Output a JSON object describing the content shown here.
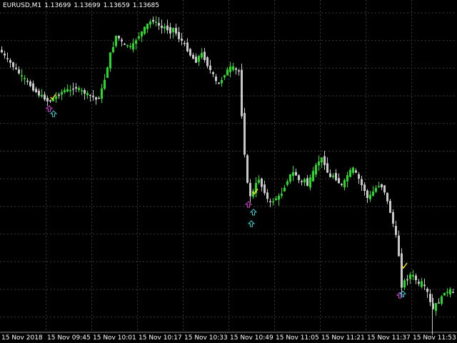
{
  "chart_header": {
    "symbol_timeframe": "EURUSD,M1",
    "open": "1.13699",
    "high": "1.13699",
    "low": "1.13659",
    "close": "1.13685"
  },
  "colors": {
    "background": "#000000",
    "grid": "#3a3a3a",
    "bull_candle": "#22dd22",
    "bear_candle": "#c8c8c8",
    "text": "#ffffff",
    "buy_arrow": "#d040d0",
    "buy_arrow_alt": "#40c8c8",
    "check_mark": "#f0e020"
  },
  "chart_data": {
    "type": "candlestick",
    "symbol": "EURUSD",
    "timeframe": "M1",
    "grid": true,
    "x_ticks": [
      "15 Nov 2018",
      "15 Nov 09:45",
      "15 Nov 10:01",
      "15 Nov 10:17",
      "15 Nov 10:33",
      "15 Nov 10:49",
      "15 Nov 11:05",
      "15 Nov 11:21",
      "15 Nov 11:37",
      "15 Nov 11:53"
    ],
    "price_path": [
      [
        0,
        1.1401
      ],
      [
        4,
        1.1399
      ],
      [
        8,
        1.1396
      ],
      [
        14,
        1.1392
      ],
      [
        20,
        1.1388
      ],
      [
        26,
        1.1384
      ],
      [
        32,
        1.138
      ],
      [
        38,
        1.1377
      ],
      [
        44,
        1.1373
      ],
      [
        50,
        1.1369
      ],
      [
        56,
        1.1366
      ],
      [
        62,
        1.1364
      ],
      [
        66,
        1.1362
      ],
      [
        70,
        1.136
      ],
      [
        76,
        1.1363
      ],
      [
        82,
        1.1365
      ],
      [
        88,
        1.1368
      ],
      [
        94,
        1.137
      ],
      [
        100,
        1.1369
      ],
      [
        106,
        1.1372
      ],
      [
        112,
        1.137
      ],
      [
        118,
        1.1368
      ],
      [
        124,
        1.1366
      ],
      [
        130,
        1.1365
      ],
      [
        136,
        1.1362
      ],
      [
        140,
        1.1364
      ],
      [
        144,
        1.137
      ],
      [
        148,
        1.1378
      ],
      [
        152,
        1.1388
      ],
      [
        156,
        1.1398
      ],
      [
        160,
        1.1404
      ],
      [
        164,
        1.1412
      ],
      [
        168,
        1.141
      ],
      [
        172,
        1.1407
      ],
      [
        176,
        1.1404
      ],
      [
        180,
        1.1405
      ],
      [
        184,
        1.1403
      ],
      [
        188,
        1.1405
      ],
      [
        192,
        1.1409
      ],
      [
        196,
        1.1412
      ],
      [
        200,
        1.1415
      ],
      [
        204,
        1.1418
      ],
      [
        208,
        1.1421
      ],
      [
        212,
        1.1423
      ],
      [
        216,
        1.1424
      ],
      [
        220,
        1.1422
      ],
      [
        224,
        1.142
      ],
      [
        228,
        1.1418
      ],
      [
        232,
        1.1419
      ],
      [
        236,
        1.1417
      ],
      [
        240,
        1.1415
      ],
      [
        244,
        1.1418
      ],
      [
        248,
        1.1414
      ],
      [
        252,
        1.141
      ],
      [
        256,
        1.1408
      ],
      [
        260,
        1.1405
      ],
      [
        264,
        1.1401
      ],
      [
        268,
        1.1397
      ],
      [
        272,
        1.1394
      ],
      [
        276,
        1.1392
      ],
      [
        280,
        1.1396
      ],
      [
        284,
        1.1398
      ],
      [
        288,
        1.1394
      ],
      [
        292,
        1.1389
      ],
      [
        296,
        1.1385
      ],
      [
        300,
        1.1381
      ],
      [
        304,
        1.1376
      ],
      [
        308,
        1.1374
      ],
      [
        312,
        1.1378
      ],
      [
        316,
        1.1382
      ],
      [
        320,
        1.1385
      ],
      [
        324,
        1.1387
      ],
      [
        328,
        1.1387
      ],
      [
        332,
        1.1385
      ],
      [
        336,
        1.1384
      ],
      [
        338,
        1.137
      ],
      [
        340,
        1.135
      ],
      [
        342,
        1.1334
      ],
      [
        344,
        1.132
      ],
      [
        346,
        1.1305
      ],
      [
        348,
        1.1296
      ],
      [
        350,
        1.129
      ],
      [
        352,
        1.1287
      ],
      [
        354,
        1.1284
      ],
      [
        356,
        1.129
      ],
      [
        360,
        1.1296
      ],
      [
        364,
        1.13
      ],
      [
        368,
        1.1294
      ],
      [
        372,
        1.129
      ],
      [
        376,
        1.1284
      ],
      [
        380,
        1.1281
      ],
      [
        384,
        1.1283
      ],
      [
        388,
        1.1285
      ],
      [
        392,
        1.1286
      ],
      [
        396,
        1.1289
      ],
      [
        400,
        1.1294
      ],
      [
        404,
        1.1299
      ],
      [
        408,
        1.1303
      ],
      [
        412,
        1.1305
      ],
      [
        416,
        1.1303
      ],
      [
        420,
        1.1299
      ],
      [
        424,
        1.1297
      ],
      [
        428,
        1.13
      ],
      [
        432,
        1.1295
      ],
      [
        436,
        1.13
      ],
      [
        440,
        1.1305
      ],
      [
        444,
        1.131
      ],
      [
        448,
        1.1314
      ],
      [
        452,
        1.1316
      ],
      [
        456,
        1.1312
      ],
      [
        460,
        1.1305
      ],
      [
        464,
        1.1301
      ],
      [
        468,
        1.1303
      ],
      [
        472,
        1.13
      ],
      [
        476,
        1.1297
      ],
      [
        480,
        1.1295
      ],
      [
        484,
        1.1298
      ],
      [
        488,
        1.1303
      ],
      [
        492,
        1.1306
      ],
      [
        496,
        1.1308
      ],
      [
        500,
        1.1304
      ],
      [
        504,
        1.13
      ],
      [
        508,
        1.1295
      ],
      [
        512,
        1.1291
      ],
      [
        516,
        1.1285
      ],
      [
        520,
        1.1287
      ],
      [
        524,
        1.129
      ],
      [
        528,
        1.1293
      ],
      [
        532,
        1.1295
      ],
      [
        536,
        1.1294
      ],
      [
        540,
        1.129
      ],
      [
        544,
        1.1282
      ],
      [
        548,
        1.1274
      ],
      [
        552,
        1.1265
      ],
      [
        556,
        1.1255
      ],
      [
        560,
        1.124
      ],
      [
        562,
        1.1225
      ],
      [
        564,
        1.1216
      ],
      [
        568,
        1.122
      ],
      [
        572,
        1.1222
      ],
      [
        576,
        1.1225
      ],
      [
        580,
        1.1224
      ],
      [
        584,
        1.1221
      ],
      [
        588,
        1.1217
      ],
      [
        592,
        1.1219
      ],
      [
        596,
        1.1215
      ],
      [
        600,
        1.1211
      ],
      [
        604,
        1.1203
      ],
      [
        608,
        1.1198
      ],
      [
        612,
        1.1202
      ],
      [
        616,
        1.1204
      ],
      [
        620,
        1.1207
      ],
      [
        624,
        1.1212
      ],
      [
        628,
        1.1211
      ],
      [
        632,
        1.1213
      ],
      [
        636,
        1.121
      ],
      [
        640,
        1.1212
      ]
    ],
    "price_range": [
      1.118,
      1.144
    ],
    "signals": [
      {
        "type": "buy-arrow",
        "color": "buy_arrow",
        "x": 69,
        "price": 1.1355
      },
      {
        "type": "buy-arrow",
        "color": "buy_arrow_alt",
        "x": 75,
        "price": 1.1351
      },
      {
        "type": "check",
        "color": "check_mark",
        "x": 74,
        "price": 1.1364
      },
      {
        "type": "buy-arrow",
        "color": "buy_arrow",
        "x": 348,
        "price": 1.128
      },
      {
        "type": "buy-arrow",
        "color": "buy_arrow_alt",
        "x": 355,
        "price": 1.1274
      },
      {
        "type": "buy-arrow",
        "color": "buy_arrow_alt",
        "x": 352,
        "price": 1.1265
      },
      {
        "type": "check",
        "color": "check_mark",
        "x": 357,
        "price": 1.129
      },
      {
        "type": "buy-arrow",
        "color": "buy_arrow",
        "x": 560,
        "price": 1.1209
      },
      {
        "type": "buy-arrow",
        "color": "buy_arrow_alt",
        "x": 564,
        "price": 1.121
      },
      {
        "type": "check",
        "color": "check_mark",
        "x": 566,
        "price": 1.1232
      }
    ]
  }
}
